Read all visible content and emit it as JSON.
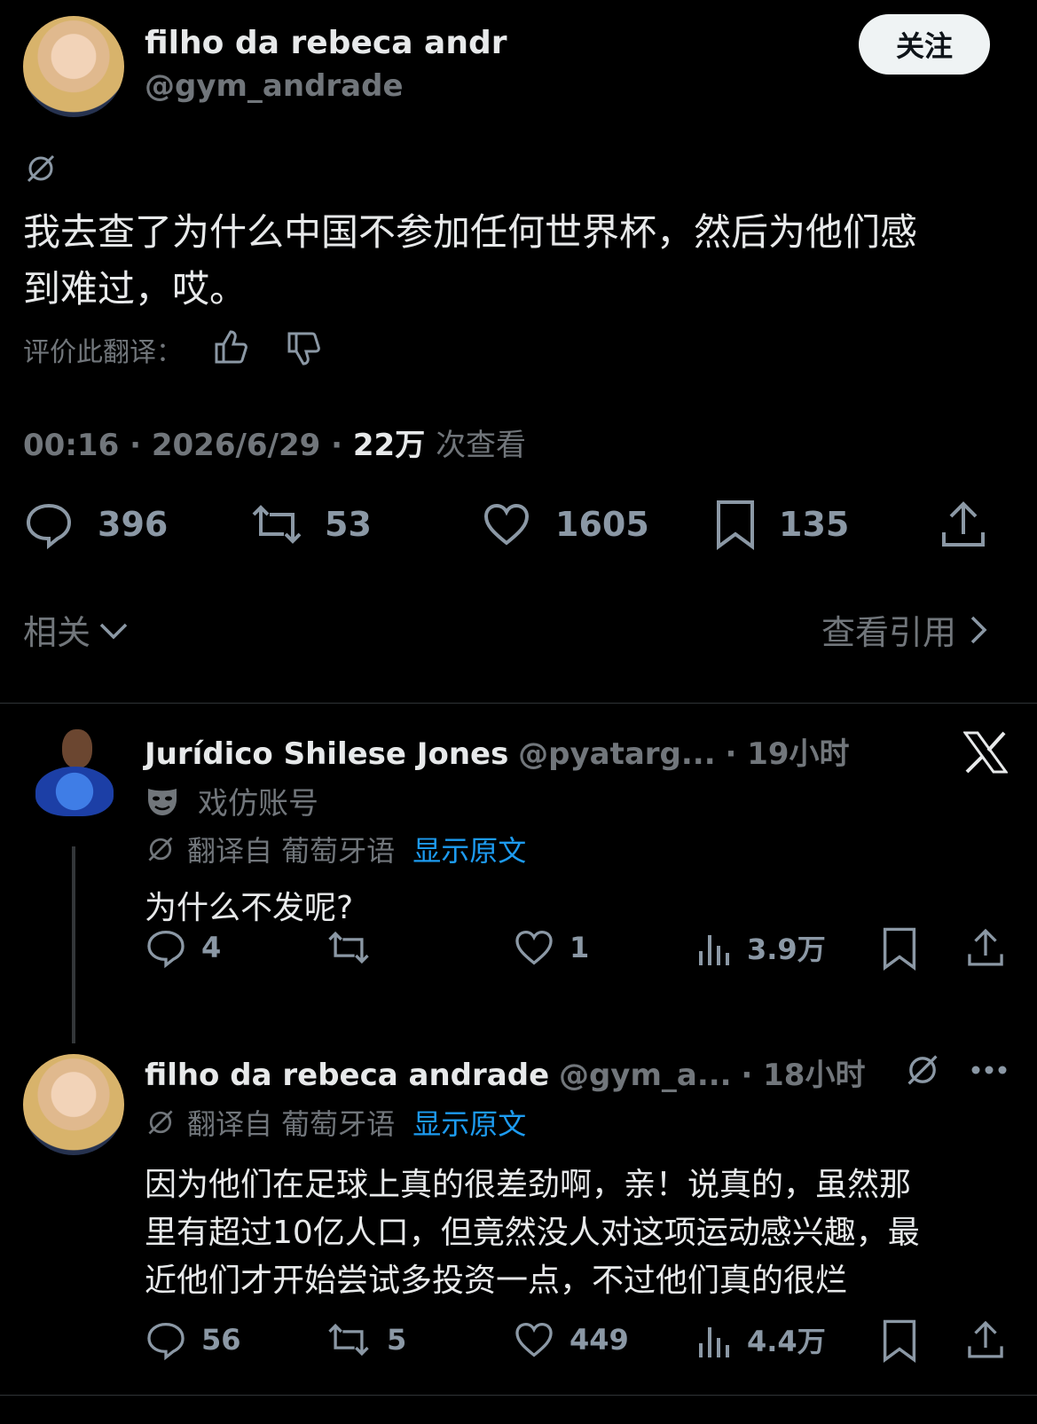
{
  "main_post": {
    "display_name": "filho da rebeca andr",
    "handle": "@gym_andrade",
    "follow_label": "关注",
    "text_line1": "我去查了为什么中国不参加任何世界杯，然后为他们感",
    "text_line2": "到难过，哎。",
    "rate_translation_label": "评价此翻译：",
    "time": "00:16",
    "date": "2026/6/29",
    "views_num": "22万",
    "views_label": "次查看",
    "sep": "·",
    "stats": {
      "replies": "396",
      "reposts": "53",
      "likes": "1605",
      "bookmarks": "135"
    },
    "related_label": "相关",
    "view_quotes_label": "查看引用"
  },
  "reply1": {
    "display_name": "Jurídico Shilese Jones",
    "handle": "@pyatarg...",
    "time": "· 19小时",
    "parody_label": "戏仿账号",
    "translated_from": "翻译自 葡萄牙语",
    "show_original": "显示原文",
    "text": "为什么不发呢?",
    "stats": {
      "replies": "4",
      "reposts": "",
      "likes": "1",
      "views": "3.9万"
    }
  },
  "reply2": {
    "display_name": "filho da rebeca andrade",
    "handle": "@gym_a...",
    "time": "· 18小时",
    "translated_from": "翻译自 葡萄牙语",
    "show_original": "显示原文",
    "text_line1": "因为他们在足球上真的很差劲啊，亲！说真的，虽然那",
    "text_line2": "里有超过10亿人口，但竟然没人对这项运动感兴趣，最",
    "text_line3": "近他们才开始尝试多投资一点，不过他们真的很烂",
    "stats": {
      "replies": "56",
      "reposts": "5",
      "likes": "449",
      "views": "4.4万"
    }
  },
  "colors": {
    "background": "#000000",
    "text": "#e7e9ea",
    "muted": "#71767b",
    "link": "#1d9bf0"
  }
}
